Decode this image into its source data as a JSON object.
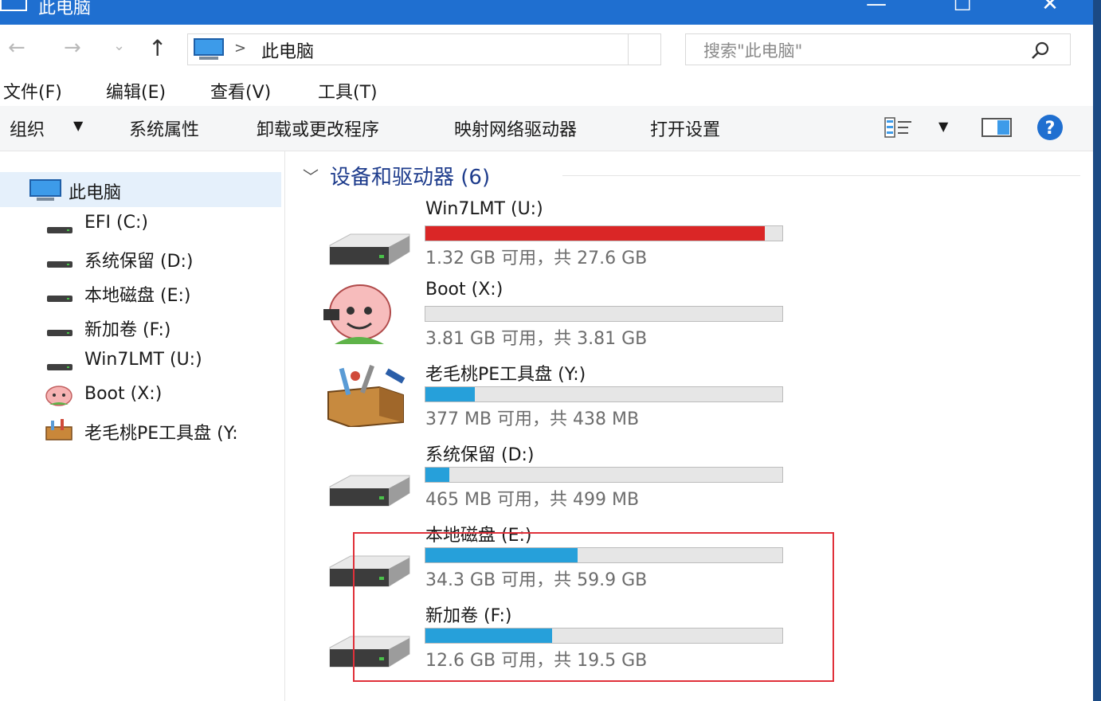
{
  "window": {
    "title": "此电脑",
    "controls": {
      "minimize": "—",
      "maximize": "☐",
      "close": "✕"
    }
  },
  "navigation": {
    "breadcrumb_separator": ">",
    "breadcrumb": "此电脑",
    "search_placeholder": "搜索\"此电脑\""
  },
  "menu": [
    "文件(F)",
    "编辑(E)",
    "查看(V)",
    "工具(T)"
  ],
  "commands": {
    "organize": "组织",
    "items": [
      "系统属性",
      "卸载或更改程序",
      "映射网络驱动器",
      "打开设置"
    ]
  },
  "sidebar": {
    "root": "此电脑",
    "items": [
      {
        "label": "EFI (C:)",
        "icon": "drive-icon"
      },
      {
        "label": "系统保留 (D:)",
        "icon": "drive-icon"
      },
      {
        "label": "本地磁盘 (E:)",
        "icon": "drive-icon"
      },
      {
        "label": "新加卷 (F:)",
        "icon": "drive-icon"
      },
      {
        "label": "Win7LMT (U:)",
        "icon": "drive-icon"
      },
      {
        "label": "Boot (X:)",
        "icon": "peach-icon"
      },
      {
        "label": "老毛桃PE工具盘 (Y:",
        "icon": "toolbox-icon"
      }
    ]
  },
  "group": {
    "title": "设备和驱动器 (6)"
  },
  "drives": [
    {
      "name": "Win7LMT (U:)",
      "info": "1.32 GB 可用，共 27.6 GB",
      "used_fraction": 0.952,
      "bar_color": "#da2626",
      "icon": "drive-icon"
    },
    {
      "name": "Boot (X:)",
      "info": "3.81 GB 可用，共 3.81 GB",
      "used_fraction": 0.0,
      "bar_color": "#26a0da",
      "icon": "peach-icon"
    },
    {
      "name": "老毛桃PE工具盘 (Y:)",
      "info": "377 MB 可用，共 438 MB",
      "used_fraction": 0.139,
      "bar_color": "#26a0da",
      "icon": "toolbox-icon"
    },
    {
      "name": "系统保留 (D:)",
      "info": "465 MB 可用，共 499 MB",
      "used_fraction": 0.068,
      "bar_color": "#26a0da",
      "icon": "drive-icon"
    },
    {
      "name": "本地磁盘 (E:)",
      "info": "34.3 GB 可用，共 59.9 GB",
      "used_fraction": 0.427,
      "bar_color": "#26a0da",
      "icon": "drive-icon"
    },
    {
      "name": "新加卷 (F:)",
      "info": "12.6 GB 可用，共 19.5 GB",
      "used_fraction": 0.354,
      "bar_color": "#26a0da",
      "icon": "drive-icon"
    }
  ],
  "colors": {
    "titlebar": "#1f6fd0",
    "accent": "#26a0da",
    "full": "#da2626",
    "annotation": "#e0303a"
  }
}
